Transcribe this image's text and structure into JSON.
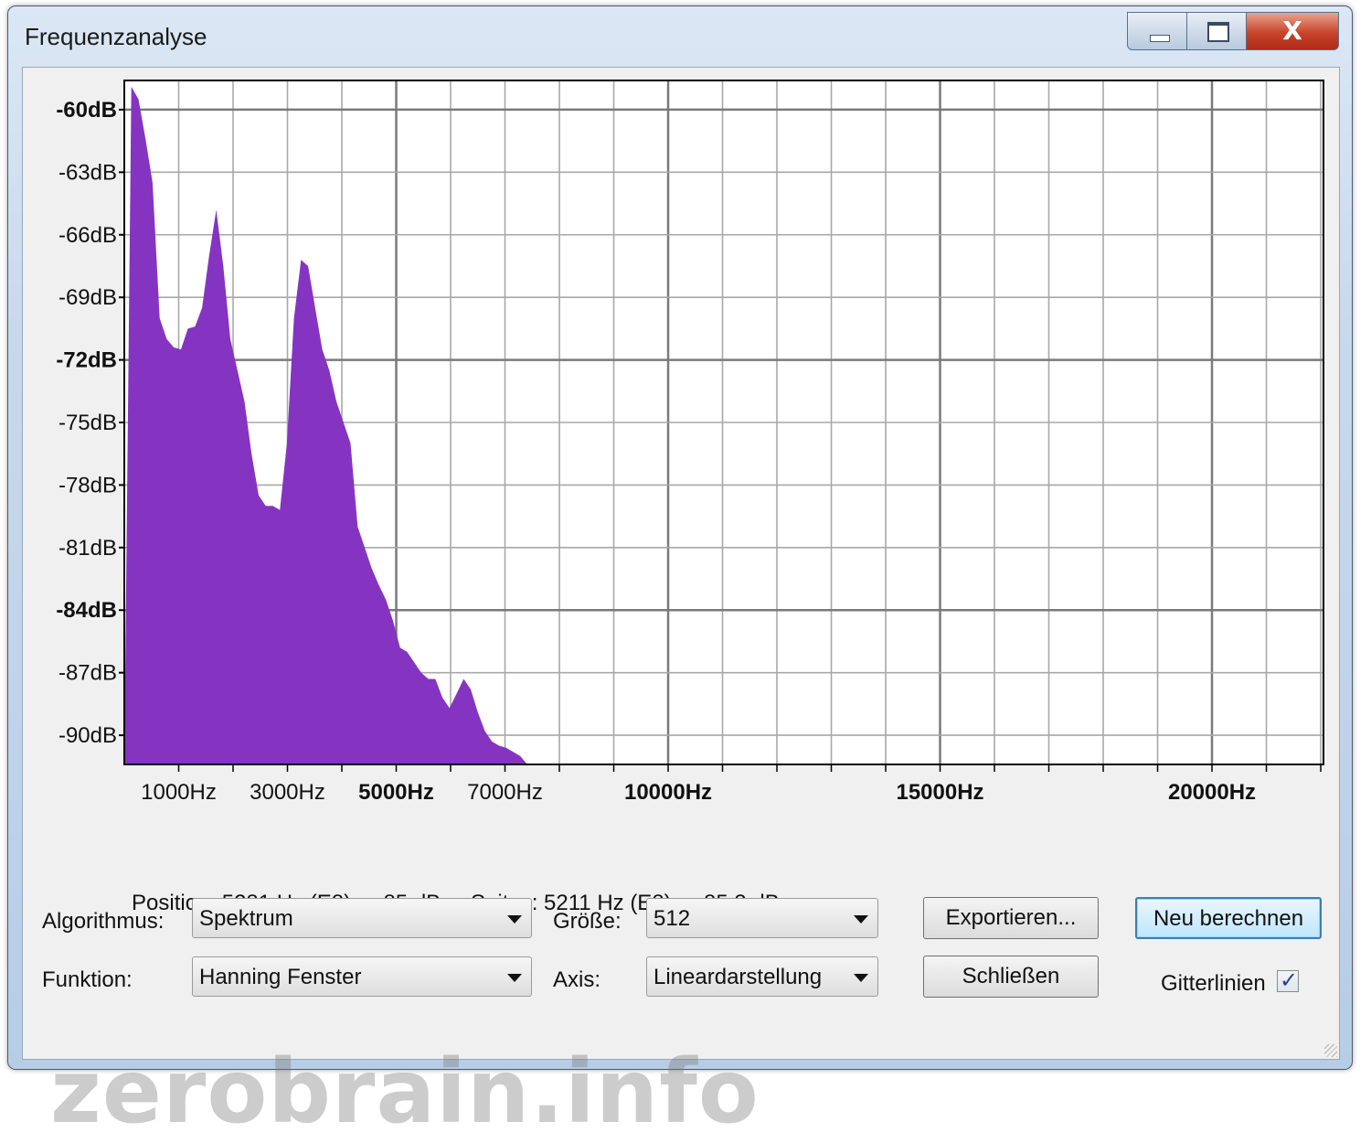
{
  "window": {
    "title": "Frequenzanalyse",
    "minimize_icon": "minimize-icon",
    "maximize_icon": "maximize-icon",
    "close_icon": "close-icon",
    "close_glyph": "X"
  },
  "chart_data": {
    "type": "area",
    "color": "#8534c2",
    "xlim": [
      0,
      22050
    ],
    "ylim": [
      -91.4,
      -58.6
    ],
    "x_ticks": [
      {
        "value": 1000,
        "label": "1000Hz",
        "bold": false
      },
      {
        "value": 3000,
        "label": "3000Hz",
        "bold": false
      },
      {
        "value": 5000,
        "label": "5000Hz",
        "bold": true
      },
      {
        "value": 7000,
        "label": "7000Hz",
        "bold": false
      },
      {
        "value": 10000,
        "label": "10000Hz",
        "bold": true
      },
      {
        "value": 15000,
        "label": "15000Hz",
        "bold": true
      },
      {
        "value": 20000,
        "label": "20000Hz",
        "bold": true
      }
    ],
    "y_ticks": [
      {
        "value": -60,
        "label": "-60dB",
        "bold": true
      },
      {
        "value": -63,
        "label": "-63dB",
        "bold": false
      },
      {
        "value": -66,
        "label": "-66dB",
        "bold": false
      },
      {
        "value": -69,
        "label": "-69dB",
        "bold": false
      },
      {
        "value": -72,
        "label": "-72dB",
        "bold": true
      },
      {
        "value": -75,
        "label": "-75dB",
        "bold": false
      },
      {
        "value": -78,
        "label": "-78dB",
        "bold": false
      },
      {
        "value": -81,
        "label": "-81dB",
        "bold": false
      },
      {
        "value": -84,
        "label": "-84dB",
        "bold": true
      },
      {
        "value": -87,
        "label": "-87dB",
        "bold": false
      },
      {
        "value": -90,
        "label": "-90dB",
        "bold": false
      }
    ],
    "grid": true,
    "x": [
      0,
      130,
      260,
      390,
      520,
      650,
      780,
      910,
      1040,
      1170,
      1300,
      1430,
      1560,
      1690,
      1820,
      1950,
      2080,
      2210,
      2340,
      2470,
      2600,
      2730,
      2860,
      2990,
      3120,
      3250,
      3380,
      3510,
      3640,
      3770,
      3900,
      4030,
      4160,
      4290,
      4420,
      4550,
      4680,
      4810,
      4940,
      5070,
      5200,
      5330,
      5460,
      5590,
      5720,
      5850,
      5980,
      6110,
      6240,
      6370,
      6500,
      6630,
      6760,
      6890,
      7020,
      7150,
      7280,
      7410
    ],
    "values": [
      -91.4,
      -58.9,
      -59.5,
      -61.4,
      -63.5,
      -70.0,
      -71.0,
      -71.4,
      -71.5,
      -70.5,
      -70.4,
      -69.5,
      -67.0,
      -64.8,
      -67.5,
      -71.0,
      -72.5,
      -74.0,
      -76.5,
      -78.5,
      -79.0,
      -79.0,
      -79.2,
      -76.0,
      -70.0,
      -67.2,
      -67.5,
      -69.5,
      -71.5,
      -72.5,
      -74.0,
      -75.0,
      -76.0,
      -80.0,
      -81.0,
      -82.0,
      -82.8,
      -83.5,
      -84.5,
      -85.8,
      -86.0,
      -86.5,
      -87.0,
      -87.3,
      -87.3,
      -88.2,
      -88.7,
      -88.0,
      -87.3,
      -87.8,
      -88.9,
      -89.8,
      -90.3,
      -90.5,
      -90.6,
      -90.8,
      -91.0,
      -91.4
    ]
  },
  "status": {
    "position": "Position: 5281 Hz (E8) = -85 dB",
    "peak": "Spitze: 5211 Hz (E8) = -85,3 dB"
  },
  "controls": {
    "algorithm_label": "Algorithmus:",
    "algorithm_value": "Spektrum",
    "size_label": "Größe:",
    "size_value": "512",
    "function_label": "Funktion:",
    "function_value": "Hanning Fenster",
    "axis_label": "Axis:",
    "axis_value": "Lineardarstellung",
    "export_button": "Exportieren...",
    "recalc_button": "Neu berechnen",
    "close_button": "Schließen",
    "gridlines_label": "Gitterlinien",
    "gridlines_checked": true
  },
  "watermark": "zerobrain.info"
}
